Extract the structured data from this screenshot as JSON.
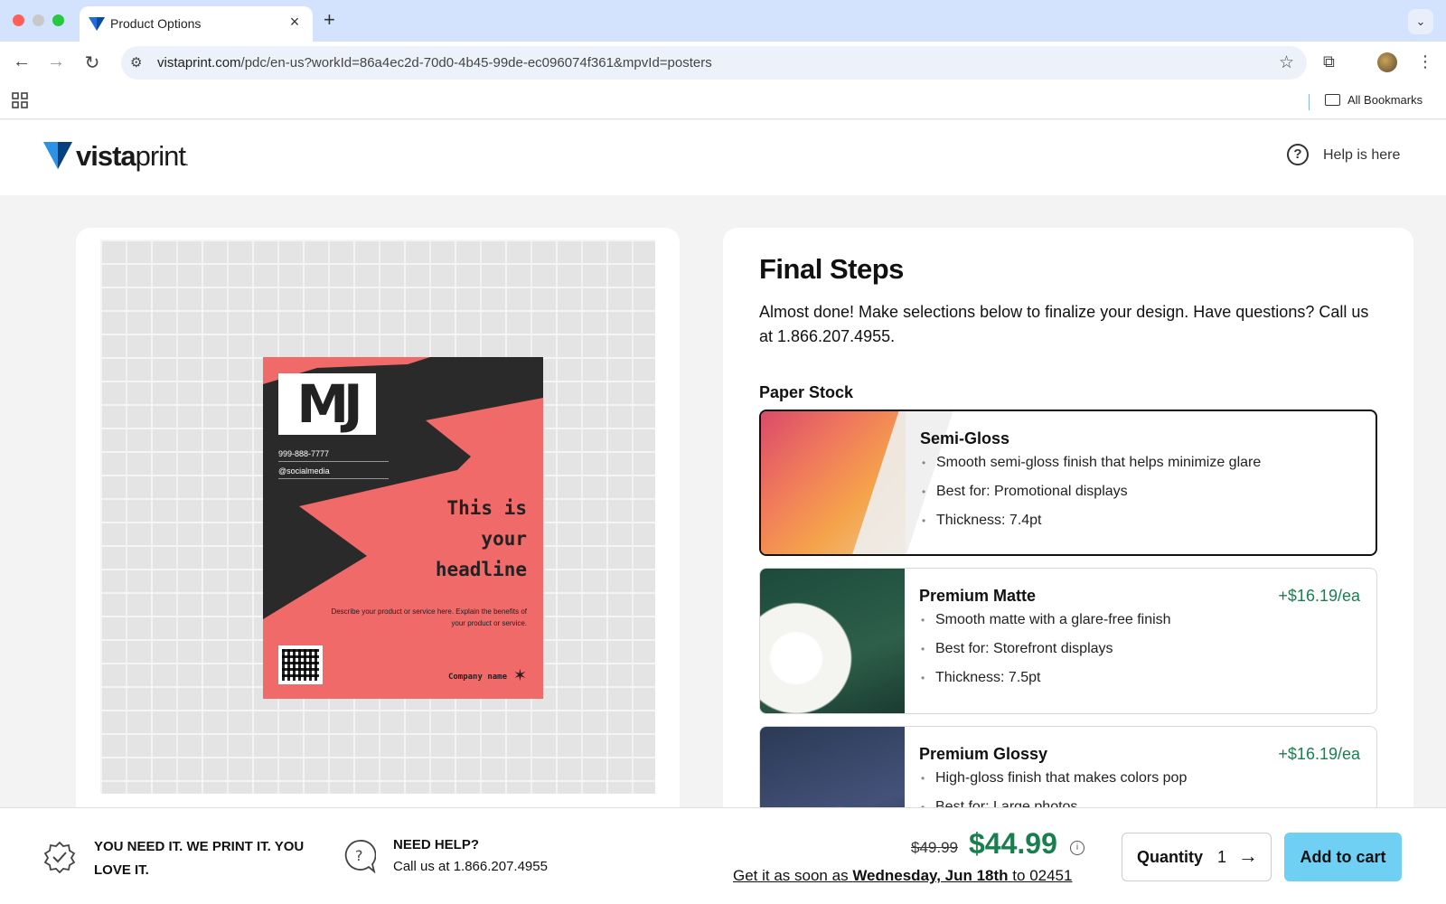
{
  "browser": {
    "tab_title": "Product Options",
    "url_host": "vistaprint.com",
    "url_path": "/pdc/en-us?workId=86a4ec2d-70d0-4b45-99de-ec096074f361&mpvId=posters",
    "bookmarks_label": "All Bookmarks"
  },
  "header": {
    "logo_text_bold": "vista",
    "logo_text_light": "print",
    "logo_reg": ".",
    "help_label": "Help is here"
  },
  "poster": {
    "initials": "MJ",
    "phone": "999-888-7777",
    "social": "@socialmedia",
    "headline_1": "This is",
    "headline_2": "your",
    "headline_3": "headline",
    "description": "Describe your product or service here. Explain the benefits of your product or service.",
    "company": "Company name"
  },
  "main": {
    "title": "Final Steps",
    "description": "Almost done! Make selections below to finalize your design. Have questions? Call us at 1.866.207.4955.",
    "paper_stock_label": "Paper Stock",
    "options": [
      {
        "name": "Semi-Gloss",
        "price": "",
        "bullets": [
          "Smooth semi-gloss finish that helps minimize glare",
          "Best for: Promotional displays",
          "Thickness: 7.4pt"
        ]
      },
      {
        "name": "Premium Matte",
        "price": "+$16.19/ea",
        "bullets": [
          "Smooth matte with a glare-free finish",
          "Best for: Storefront displays",
          "Thickness: 7.5pt"
        ]
      },
      {
        "name": "Premium Glossy",
        "price": "+$16.19/ea",
        "bullets": [
          "High-gloss finish that makes colors pop",
          "Best for: Large photos"
        ]
      }
    ]
  },
  "footer": {
    "guarantee": "YOU NEED IT. WE PRINT IT. YOU LOVE IT.",
    "help_title": "NEED HELP?",
    "help_phone": "Call us at 1.866.207.4955",
    "old_price": "$49.99",
    "new_price": "$44.99",
    "delivery_prefix": "Get it as soon as",
    "delivery_date": "Wednesday, Jun 18th",
    "delivery_suffix": "to 02451",
    "quantity_label": "Quantity",
    "quantity_value": "1",
    "add_to_cart": "Add to cart"
  },
  "colors": {
    "accent_price": "#1a7f4f",
    "cta": "#70d0f3",
    "poster_red": "#ef6a69"
  }
}
